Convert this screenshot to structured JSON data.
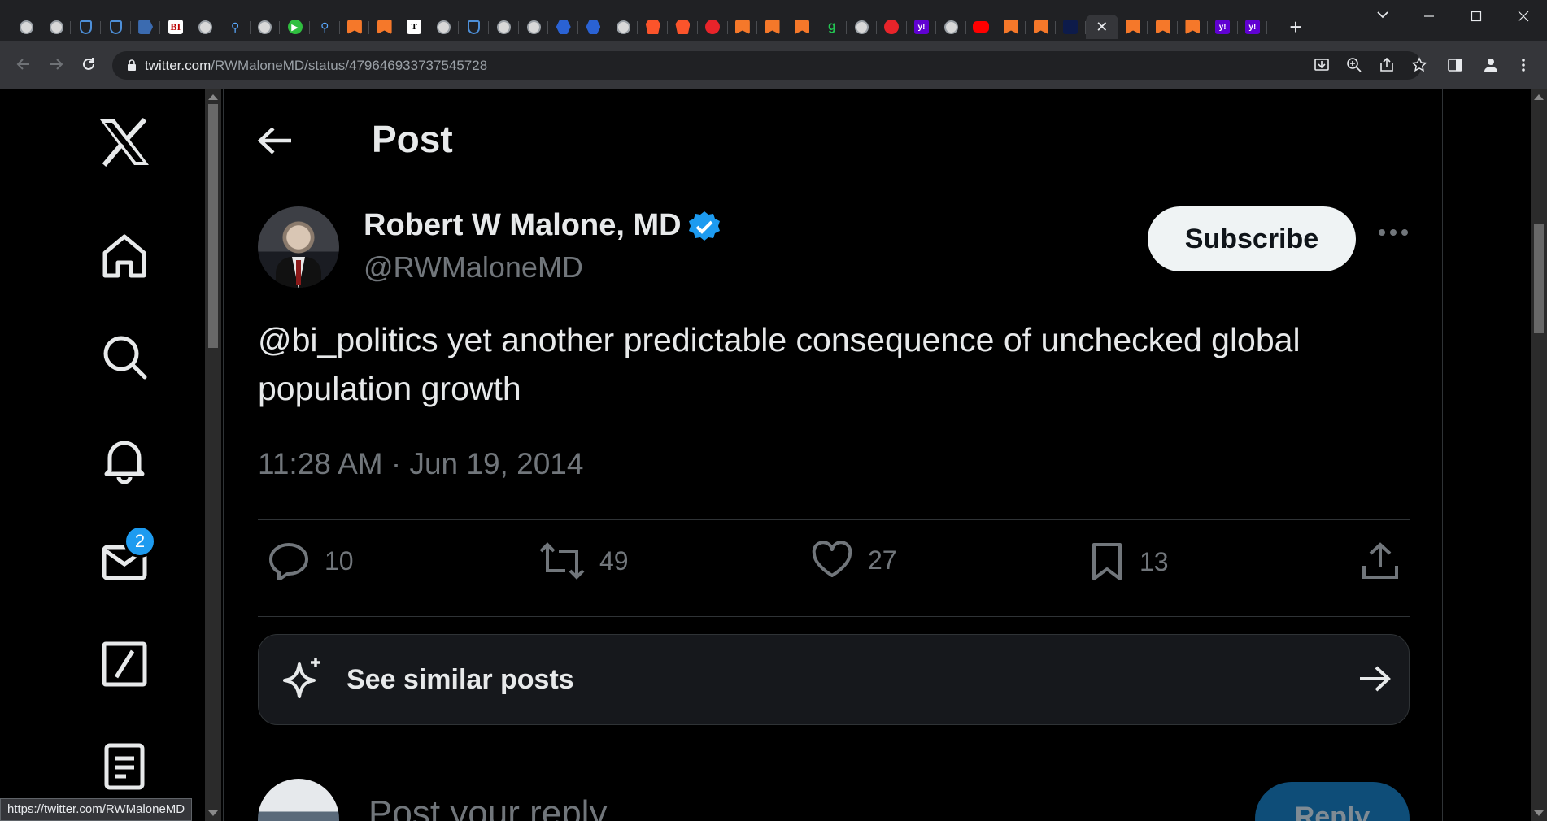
{
  "browser": {
    "tabs": [
      {
        "icon": "globe-icon"
      },
      {
        "icon": "globe-icon"
      },
      {
        "icon": "shield-icon"
      },
      {
        "icon": "shield-icon"
      },
      {
        "icon": "flag-icon"
      },
      {
        "icon": "bi-icon",
        "text": "BI"
      },
      {
        "icon": "globe-icon"
      },
      {
        "icon": "search-icon"
      },
      {
        "icon": "globe-icon"
      },
      {
        "icon": "play-icon"
      },
      {
        "icon": "search-icon"
      },
      {
        "icon": "substack-icon"
      },
      {
        "icon": "substack-icon"
      },
      {
        "icon": "newspaper-icon",
        "text": "T"
      },
      {
        "icon": "globe-icon"
      },
      {
        "icon": "shield-icon"
      },
      {
        "icon": "globe-icon"
      },
      {
        "icon": "globe-icon"
      },
      {
        "icon": "hexagon-icon"
      },
      {
        "icon": "hexagon-icon"
      },
      {
        "icon": "globe-icon"
      },
      {
        "icon": "brave-icon"
      },
      {
        "icon": "brave-icon"
      },
      {
        "icon": "microphone-icon"
      },
      {
        "icon": "substack-icon"
      },
      {
        "icon": "substack-icon"
      },
      {
        "icon": "substack-icon"
      },
      {
        "icon": "g-icon",
        "text": "g"
      },
      {
        "icon": "globe-icon"
      },
      {
        "icon": "microphone-icon"
      },
      {
        "icon": "yahoo-icon",
        "text": "y!"
      },
      {
        "icon": "globe-icon"
      },
      {
        "icon": "youtube-icon"
      },
      {
        "icon": "substack-icon"
      },
      {
        "icon": "substack-icon"
      },
      {
        "icon": "dark-app-icon"
      },
      {
        "icon": "close-icon",
        "active": true
      },
      {
        "icon": "substack-icon"
      },
      {
        "icon": "substack-icon"
      },
      {
        "icon": "substack-icon"
      },
      {
        "icon": "yahoo-icon",
        "text": "y!"
      },
      {
        "icon": "yahoo-icon",
        "text": "y!"
      }
    ],
    "new_tab_label": "+",
    "url_host": "twitter.com",
    "url_path": "/RWMaloneMD/status/479646933737545728",
    "status_link": "https://twitter.com/RWMaloneMD"
  },
  "sidebar": {
    "nav": [
      "x-logo-icon",
      "home-icon",
      "search-icon",
      "bell-icon",
      "mail-icon",
      "grok-icon",
      "lists-icon"
    ],
    "messages_badge": "2"
  },
  "post": {
    "header_title": "Post",
    "author_name": "Robert W Malone, MD",
    "author_handle": "@RWMaloneMD",
    "subscribe_label": "Subscribe",
    "text": "@bi_politics yet another predictable consequence of unchecked global population growth",
    "timestamp": "11:28 AM · Jun 19, 2014",
    "actions": {
      "replies": "10",
      "reposts": "49",
      "likes": "27",
      "bookmarks": "13"
    },
    "similar_label": "See similar posts",
    "reply_placeholder": "Post your reply",
    "reply_button": "Reply"
  },
  "colors": {
    "accent": "#1d9bf0",
    "background": "#000000",
    "text": "#e7e9ea",
    "muted": "#71767b"
  }
}
